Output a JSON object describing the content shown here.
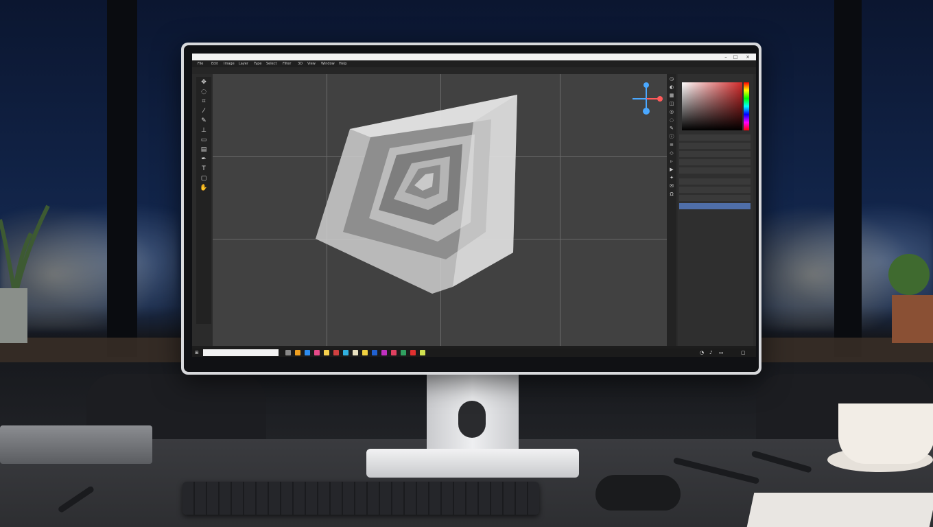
{
  "app": {
    "title": "",
    "menu_items": [
      "File",
      "Edit",
      "Image",
      "Layer",
      "Type",
      "Select",
      "Filter",
      "3D",
      "View",
      "Window",
      "Help"
    ],
    "toolbar_items": [
      "",
      "",
      "",
      "",
      "",
      "",
      "",
      "",
      "",
      ""
    ],
    "canvas_info": [
      "",
      "",
      ""
    ],
    "panel_tab": "",
    "layers": [
      {
        "label": "",
        "selected": false
      },
      {
        "label": "",
        "selected": false
      },
      {
        "label": "",
        "selected": false
      },
      {
        "label": "",
        "selected": false
      },
      {
        "label": "",
        "selected": false
      },
      {
        "label": "",
        "selected": false
      },
      {
        "label": "",
        "selected": false
      },
      {
        "label": "",
        "selected": false
      },
      {
        "label": "",
        "selected": true
      }
    ],
    "taskbar_search_placeholder": "",
    "accent_color": "#4f6ea8"
  },
  "tools_left": [
    "move-icon",
    "lasso-icon",
    "crop-icon",
    "eyedropper-icon",
    "brush-icon",
    "stamp-icon",
    "eraser-icon",
    "gradient-icon",
    "pen-icon",
    "text-icon",
    "shape-icon",
    "hand-icon"
  ],
  "tools_right": [
    "history-icon",
    "adjust-icon",
    "swatch-icon",
    "layers-icon",
    "channels-icon",
    "paths-icon",
    "brush-settings-icon",
    "info-icon",
    "properties-icon",
    "3d-icon",
    "timeline-icon",
    "actions-icon",
    "styles-icon",
    "notes-icon",
    "glyphs-icon"
  ]
}
